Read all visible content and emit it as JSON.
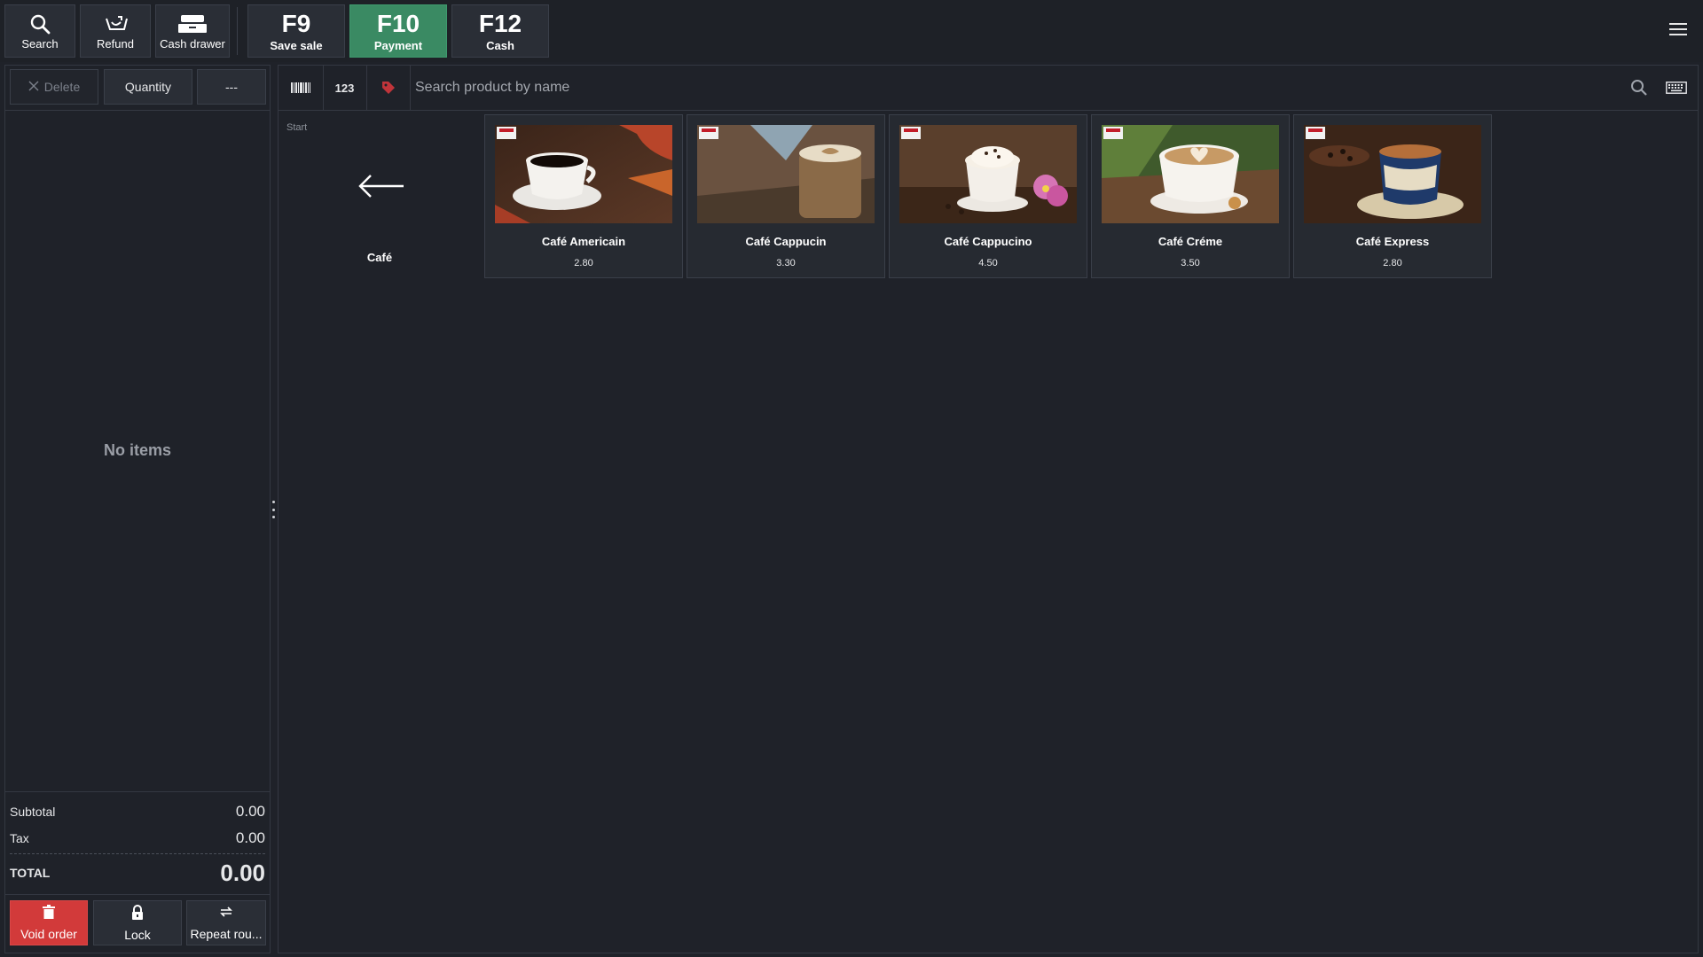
{
  "toolbar": {
    "search_label": "Search",
    "refund_label": "Refund",
    "cash_drawer_label": "Cash drawer",
    "f9": {
      "key": "F9",
      "label": "Save sale"
    },
    "f10": {
      "key": "F10",
      "label": "Payment"
    },
    "f12": {
      "key": "F12",
      "label": "Cash"
    }
  },
  "order": {
    "delete_label": "Delete",
    "quantity_label": "Quantity",
    "more_label": "---",
    "empty_text": "No items",
    "subtotal_label": "Subtotal",
    "subtotal_value": "0.00",
    "tax_label": "Tax",
    "tax_value": "0.00",
    "total_label": "TOTAL",
    "total_value": "0.00",
    "void_label": "Void order",
    "lock_label": "Lock",
    "repeat_label": "Repeat rou..."
  },
  "catalog": {
    "barcode_icon": "barcode-icon",
    "numeric_label": "123",
    "search_placeholder": "Search product by name",
    "breadcrumb": "Start",
    "category_label": "Café",
    "products": [
      {
        "name": "Café Americain",
        "price": "2.80"
      },
      {
        "name": "Café Cappucin",
        "price": "3.30"
      },
      {
        "name": "Café Cappucino",
        "price": "4.50"
      },
      {
        "name": "Café Créme",
        "price": "3.50"
      },
      {
        "name": "Café Express",
        "price": "2.80"
      }
    ]
  },
  "colors": {
    "background": "#1f2229",
    "accent_payment": "#3a8a63",
    "danger": "#d23a3a"
  }
}
